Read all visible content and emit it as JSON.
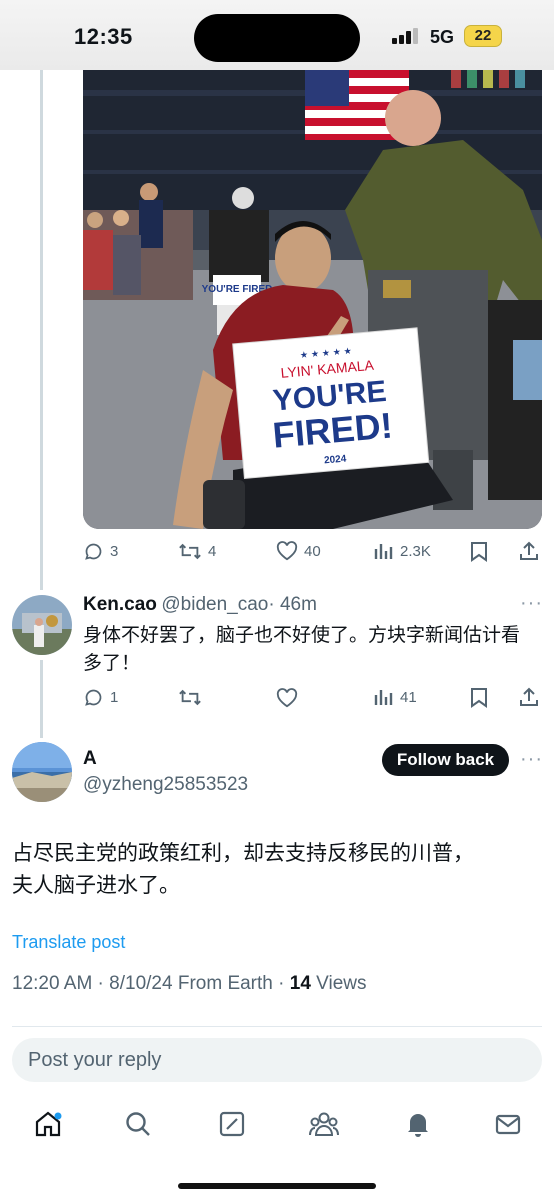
{
  "status_bar": {
    "time": "12:35",
    "network": "5G",
    "battery": "22"
  },
  "photo": {
    "sign_small": "LYIN' KAMALA",
    "sign_big1": "YOU'RE",
    "sign_big2": "FIRED!",
    "sign_year": "2024",
    "sign_back": "YOU'RE FIRED"
  },
  "tweet_actions": {
    "replies": "3",
    "reposts": "4",
    "likes": "40",
    "views": "2.3K"
  },
  "reply": {
    "name": "Ken.cao",
    "handle": "@biden_cao",
    "time": "· 46m",
    "text": "身体不好罢了，脑子也不好使了。方块字新闻估计看多了！",
    "replies": "1",
    "views": "41"
  },
  "main_post": {
    "name": "A",
    "handle": "@yzheng25853523",
    "follow_label": "Follow back",
    "text_line1": "占尽民主党的政策红利，却去支持反移民的川普，",
    "text_line2": "夫人脑子进水了。",
    "translate_label": "Translate post",
    "meta_prefix": "12:20 AM · 8/10/24 From Earth · ",
    "views_count": "14",
    "views_label": " Views"
  },
  "reply_box": {
    "placeholder": "Post your reply"
  },
  "colors": {
    "accent": "#1d9bf0",
    "text": "#0f1419",
    "secondary": "#536471"
  },
  "nav_icons": [
    "home-icon",
    "search-icon",
    "compose-icon",
    "communities-icon",
    "notifications-icon",
    "messages-icon"
  ]
}
